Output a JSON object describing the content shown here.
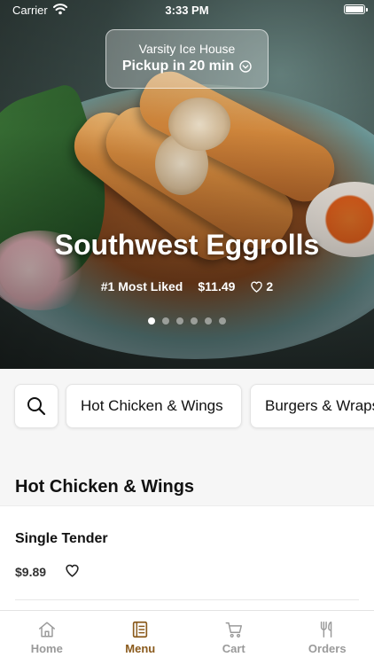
{
  "status_bar": {
    "carrier": "Carrier",
    "time": "3:33 PM"
  },
  "pickup": {
    "venue": "Varsity Ice House",
    "line": "Pickup in 20 min"
  },
  "hero": {
    "title": "Southwest Eggrolls",
    "rank": "#1 Most Liked",
    "price": "$11.49",
    "likes": "2",
    "slides_count": 6,
    "active_slide": 1
  },
  "categories": [
    "Hot Chicken & Wings",
    "Burgers & Wraps"
  ],
  "section": {
    "title": "Hot Chicken & Wings"
  },
  "items": [
    {
      "name": "Single Tender",
      "price": "$9.89"
    }
  ],
  "tabs": [
    {
      "label": "Home",
      "icon": "home-icon"
    },
    {
      "label": "Menu",
      "icon": "menu-icon",
      "active": true
    },
    {
      "label": "Cart",
      "icon": "cart-icon"
    },
    {
      "label": "Orders",
      "icon": "utensils-icon"
    }
  ],
  "colors": {
    "accent": "#8a5a1c",
    "inactive": "#9a9a9a"
  }
}
